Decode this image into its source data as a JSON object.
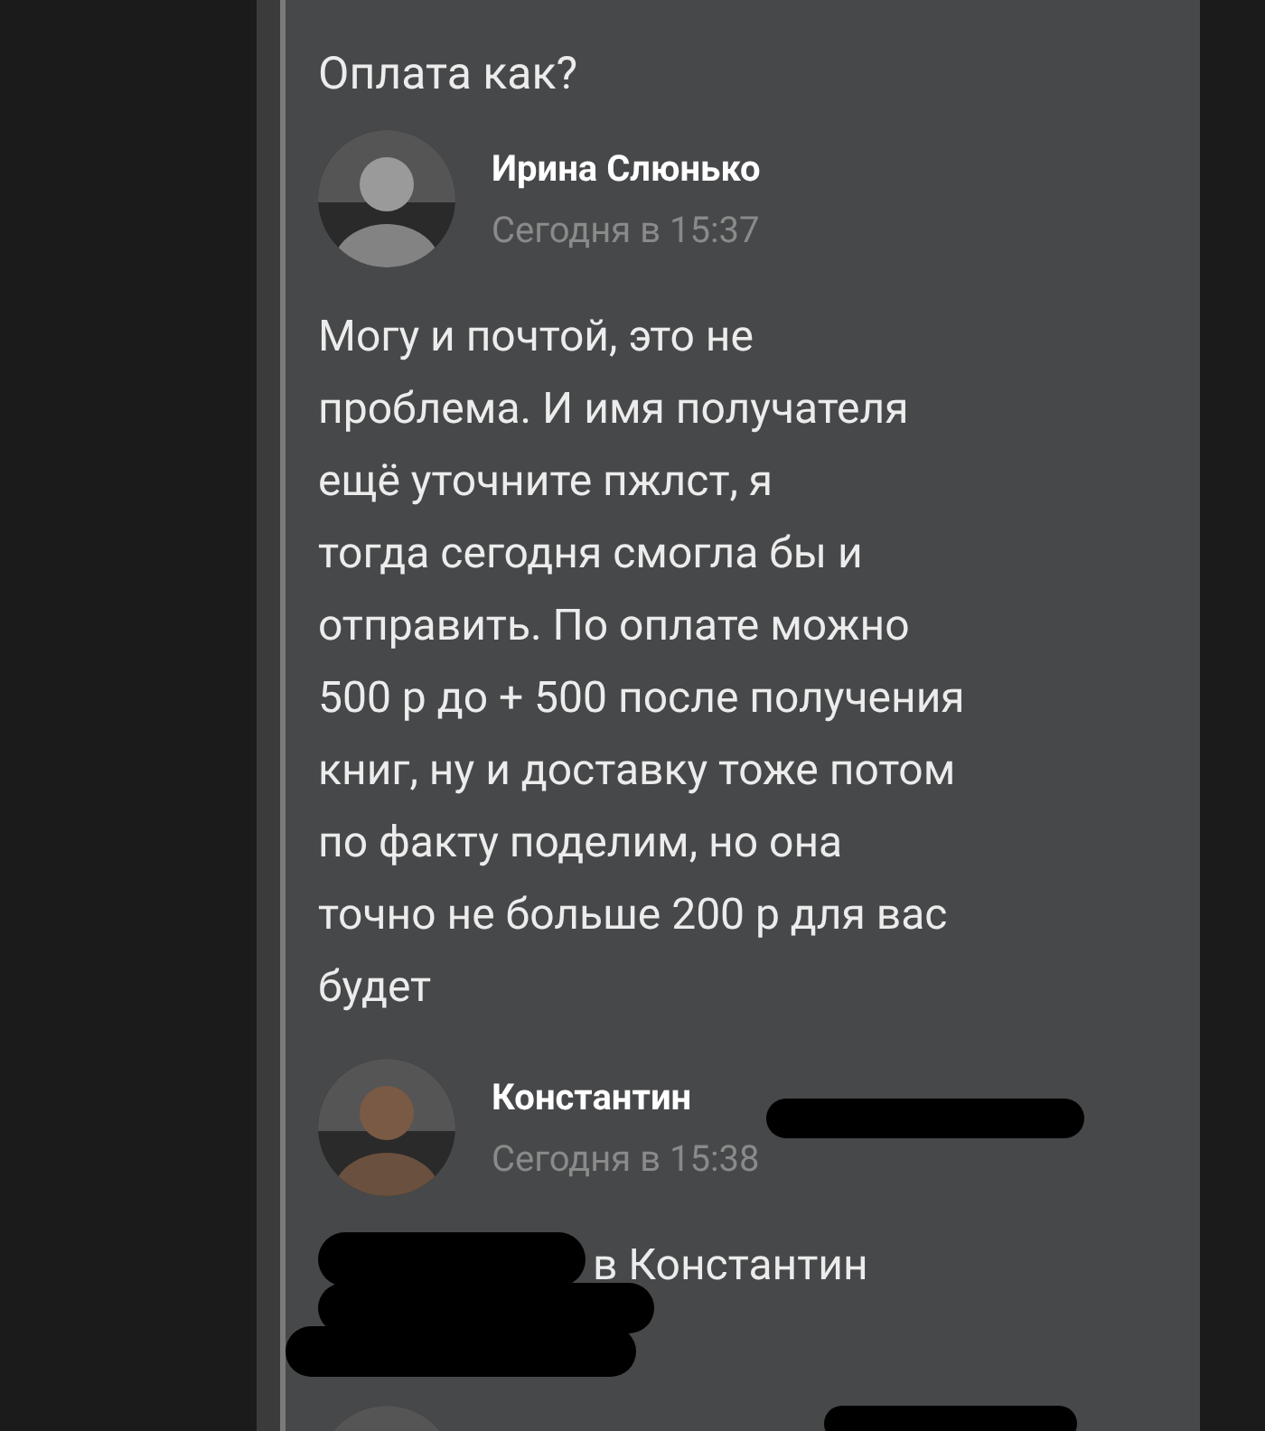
{
  "messages": [
    {
      "kind": "text_only",
      "body": "Оплата как?"
    },
    {
      "kind": "full",
      "author": "Ирина Слюнько",
      "time": "Сегодня в 15:37",
      "body": "Могу и почтой, это не\nпроблема. И имя получателя\nещё уточните пжлст, я\nтогда сегодня смогла бы и\nотправить. По оплате можно\n500 р до + 500 после получения\nкниг, ну и доставку тоже потом\nпо факту поделим, но она\nточно не больше 200 р для вас\nбудет"
    },
    {
      "kind": "full",
      "author": "Константин",
      "time": "Сегодня в 15:38",
      "author_redacted": true,
      "body": "в Константин",
      "body_redacted": true
    },
    {
      "kind": "cut",
      "author_redacted": true
    }
  ]
}
